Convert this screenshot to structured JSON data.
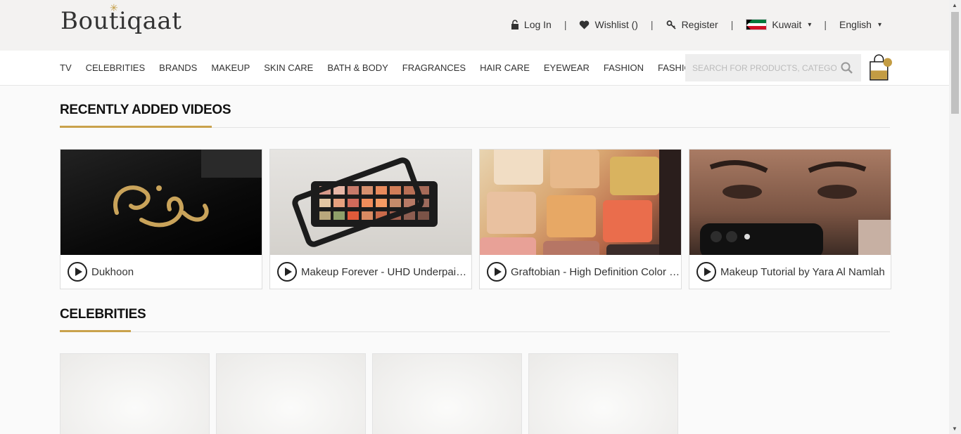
{
  "header": {
    "logo_text": "Boutiqaat",
    "login": "Log In",
    "wishlist": "Wishlist ()",
    "register": "Register",
    "country": "Kuwait",
    "language": "English"
  },
  "nav": {
    "items": [
      "TV",
      "CELEBRITIES",
      "BRANDS",
      "MAKEUP",
      "SKIN CARE",
      "BATH & BODY",
      "FRAGRANCES",
      "HAIR CARE",
      "EYEWEAR",
      "FASHION",
      "FASHION TECH"
    ],
    "search_placeholder": "SEARCH FOR PRODUCTS, CATEGORIES, BRANDS"
  },
  "videos": {
    "title": "RECENTLY ADDED VIDEOS",
    "items": [
      {
        "title": "Dukhoon"
      },
      {
        "title": "Makeup Forever - UHD Underpainting Palette"
      },
      {
        "title": "Graftobian - High Definition Color Palette"
      },
      {
        "title": "Makeup Tutorial by Yara Al Namlah"
      }
    ]
  },
  "celebrities": {
    "title": "CELEBRITIES"
  },
  "colors": {
    "accent": "#c9a24c",
    "cart_badge": "#c39c43"
  }
}
